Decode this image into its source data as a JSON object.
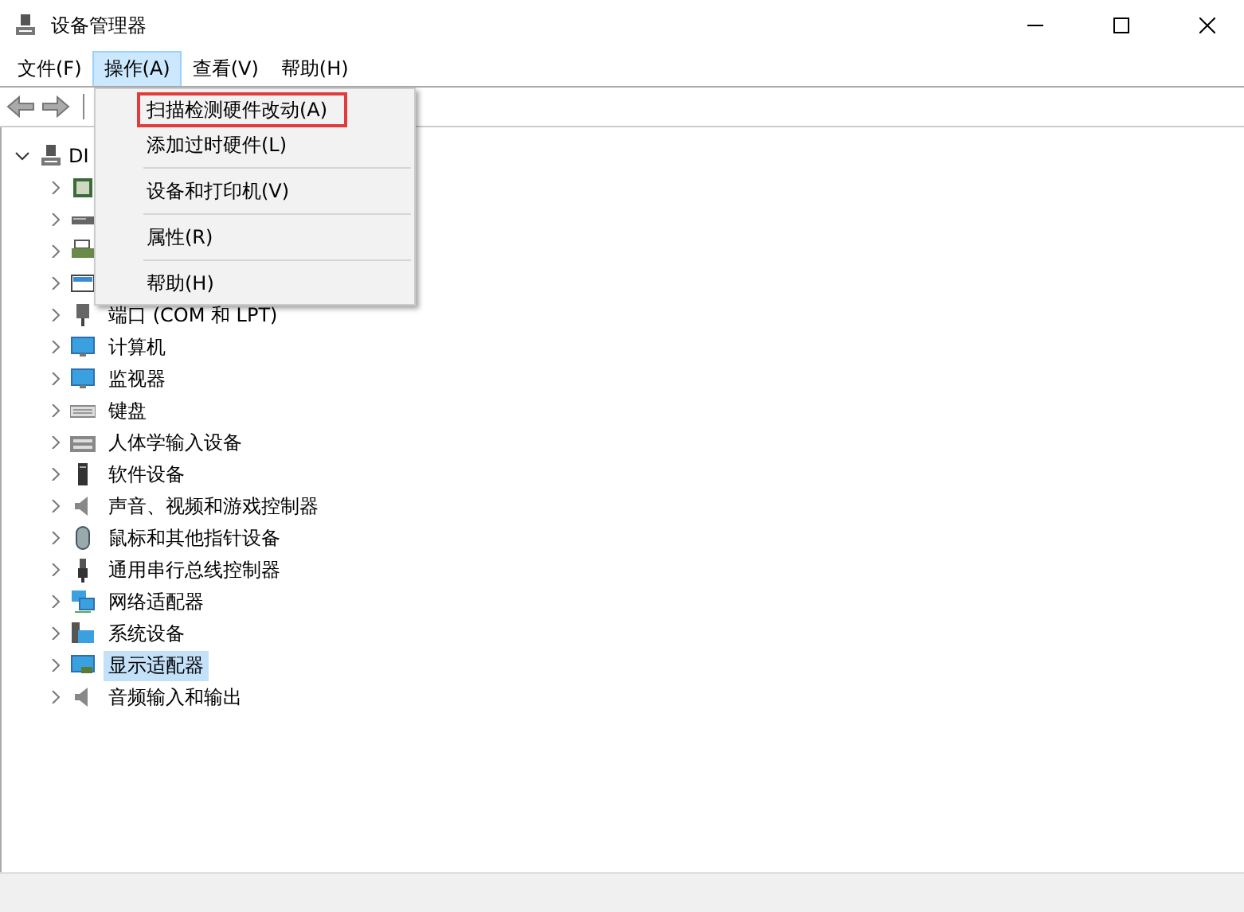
{
  "window": {
    "title": "设备管理器"
  },
  "menu_bar": [
    {
      "label": "文件(F)",
      "selected": false
    },
    {
      "label": "操作(A)",
      "selected": true
    },
    {
      "label": "查看(V)",
      "selected": false
    },
    {
      "label": "帮助(H)",
      "selected": false
    }
  ],
  "open_menu": {
    "items": [
      {
        "label": "扫描检测硬件改动(A)",
        "annotated": true,
        "separator_after": false
      },
      {
        "label": "添加过时硬件(L)",
        "annotated": false,
        "separator_after": true
      },
      {
        "label": "设备和打印机(V)",
        "annotated": false,
        "separator_after": true
      },
      {
        "label": "属性(R)",
        "annotated": false,
        "separator_after": true
      },
      {
        "label": "帮助(H)",
        "annotated": false,
        "separator_after": false
      }
    ]
  },
  "tree": {
    "label": "DI",
    "kind": "computer",
    "expanded": true,
    "children": [
      {
        "kind": "chip"
      },
      {
        "kind": "drive"
      },
      {
        "kind": "printer"
      },
      {
        "kind": "queue"
      },
      {
        "label": "端口 (COM 和 LPT)",
        "kind": "port",
        "selected": false
      },
      {
        "label": "计算机",
        "kind": "monitor",
        "selected": false
      },
      {
        "label": "监视器",
        "kind": "monitor",
        "selected": false
      },
      {
        "label": "键盘",
        "kind": "keyboard",
        "selected": false
      },
      {
        "label": "人体学输入设备",
        "kind": "hid",
        "selected": false
      },
      {
        "label": "软件设备",
        "kind": "tower",
        "selected": false
      },
      {
        "label": "声音、视频和游戏控制器",
        "kind": "speaker",
        "selected": false
      },
      {
        "label": "鼠标和其他指针设备",
        "kind": "mouse",
        "selected": false
      },
      {
        "label": "通用串行总线控制器",
        "kind": "usb",
        "selected": false
      },
      {
        "label": "网络适配器",
        "kind": "network",
        "selected": false
      },
      {
        "label": "系统设备",
        "kind": "system",
        "selected": false
      },
      {
        "label": "显示适配器",
        "kind": "display",
        "selected": true
      },
      {
        "label": "音频输入和输出",
        "kind": "speaker",
        "selected": false
      }
    ]
  }
}
